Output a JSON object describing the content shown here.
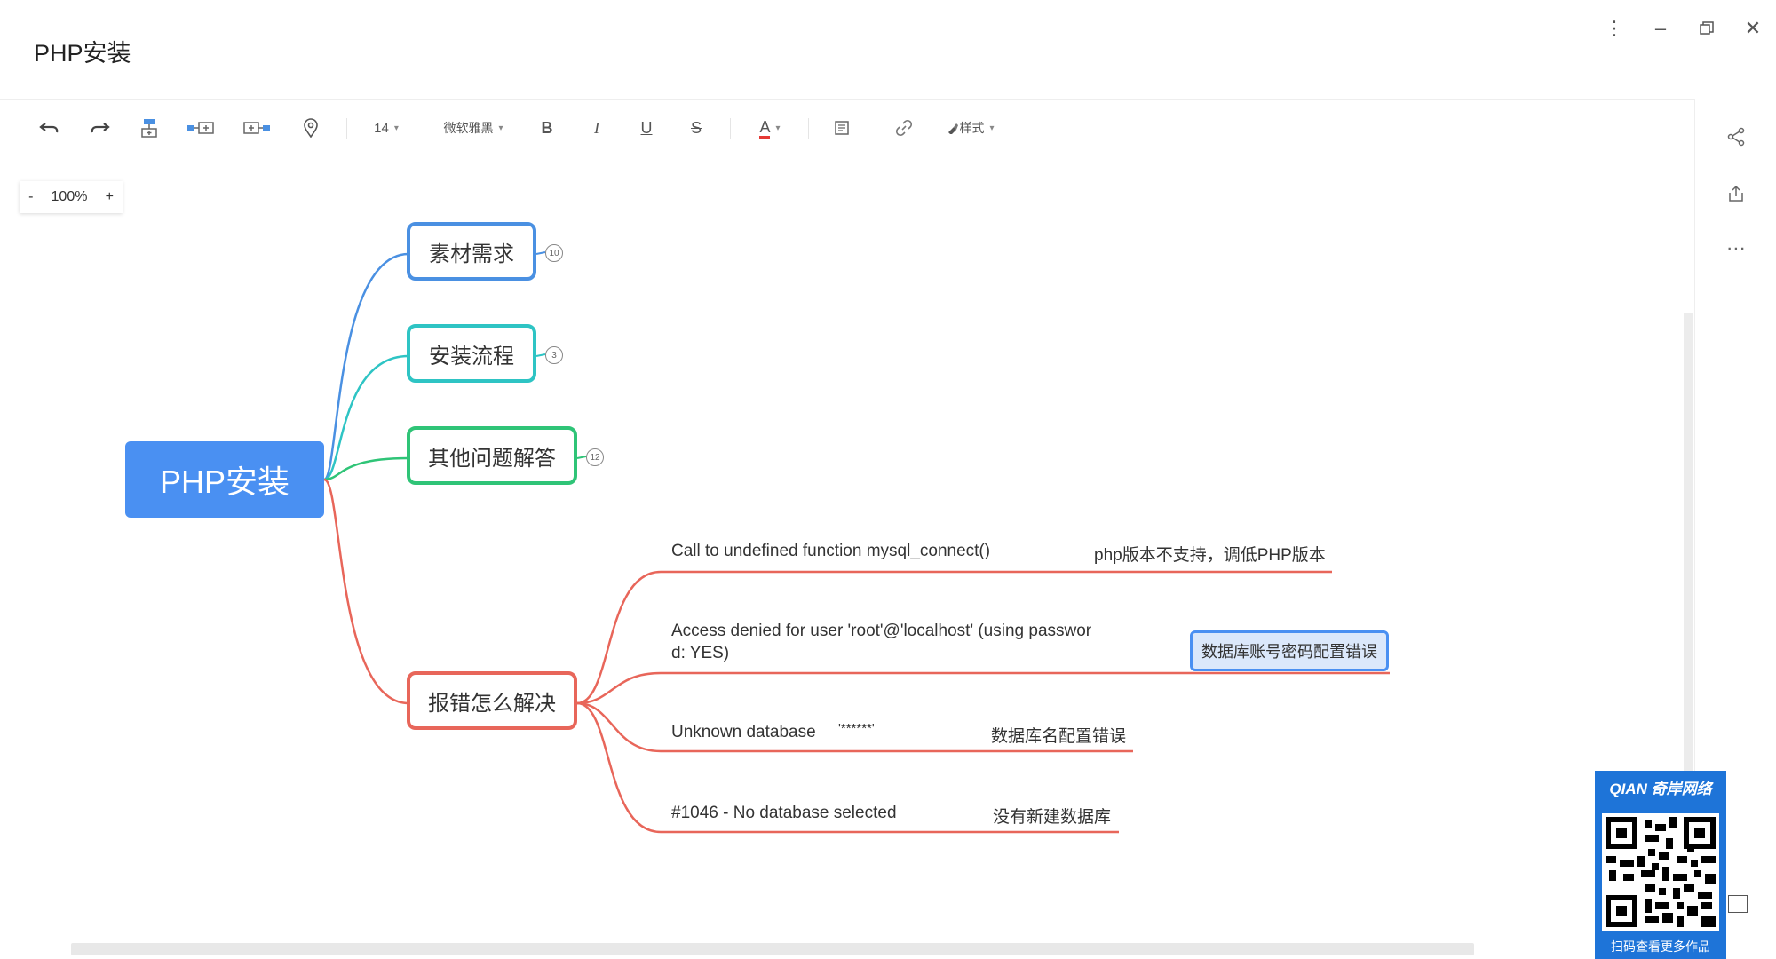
{
  "window": {
    "title": "PHP安装",
    "controls": [
      "more-vertical-icon",
      "minimize-icon",
      "restore-icon",
      "close-icon"
    ]
  },
  "toolbar": {
    "font_size": "14",
    "font_family": "微软雅黑",
    "bold": "B",
    "italic": "I",
    "underline": "U",
    "strike": "S",
    "font_color": "A",
    "style_label": "样式"
  },
  "zoom": {
    "minus": "-",
    "value": "100%",
    "plus": "+"
  },
  "mindmap": {
    "root": "PHP安装",
    "topics": [
      {
        "label": "素材需求",
        "badge": "10",
        "color": "#4a90e2"
      },
      {
        "label": "安装流程",
        "badge": "3",
        "color": "#2ec4c4"
      },
      {
        "label": "其他问题解答",
        "badge": "12",
        "color": "#2fc477"
      },
      {
        "label": "报错怎么解决",
        "badge": "",
        "color": "#e8665a"
      }
    ],
    "errors": [
      {
        "message": "Call to undefined function mysql_connect()",
        "note": "php版本不支持，调低PHP版本"
      },
      {
        "message_line1": "Access denied for user 'root'@'localhost' (using passwor",
        "message_line2": "d: YES)",
        "note": "数据库账号密码配置错误"
      },
      {
        "message": "Unknown database",
        "stars": "'******'",
        "note": "数据库名配置错误"
      },
      {
        "message": "#1046 - No database selected",
        "note": "没有新建数据库"
      }
    ]
  },
  "promo": {
    "brand": "QIAN 奇岸网络",
    "caption": "扫码查看更多作品"
  }
}
